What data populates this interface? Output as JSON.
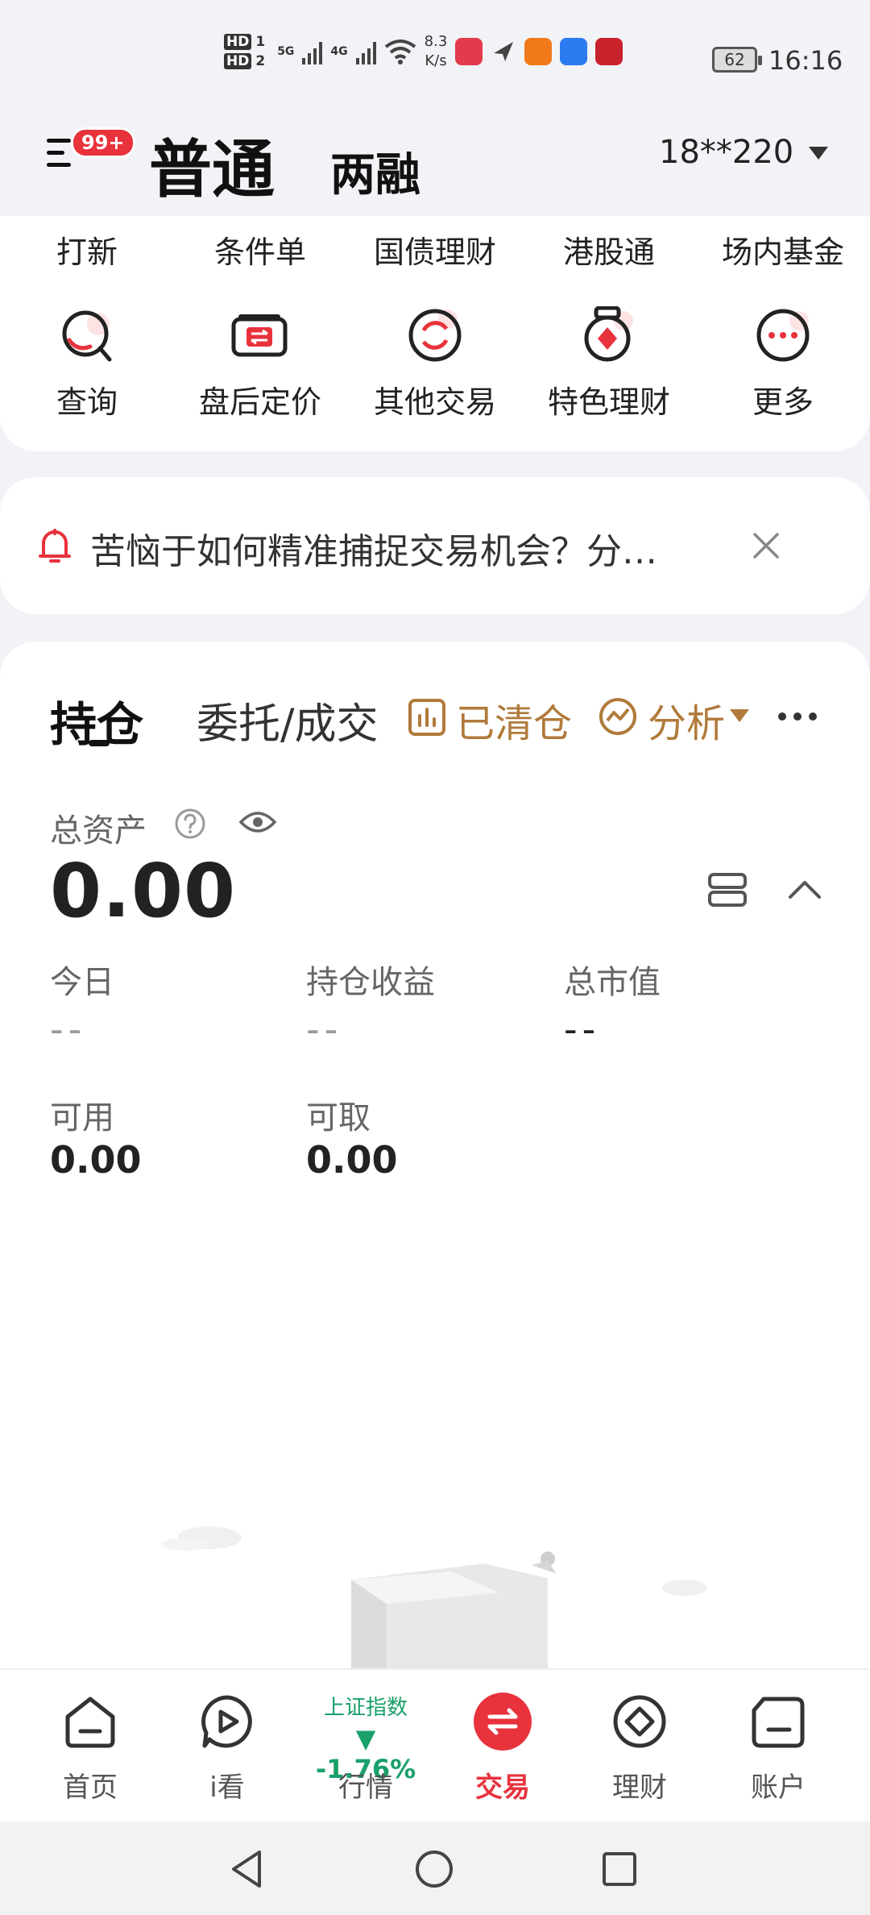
{
  "status_bar": {
    "hd1": "HD",
    "hd1_sub": "1",
    "hd2": "HD",
    "hd2_sub": "2",
    "net1": "5G",
    "net2": "4G",
    "speed_value": "8.3",
    "speed_unit": "K/s",
    "battery": "62",
    "time": "16:16"
  },
  "header": {
    "badge": "99+",
    "tab_normal": "普通",
    "tab_margin": "两融",
    "account": "18**220"
  },
  "quick_links": [
    "打新",
    "条件单",
    "国债理财",
    "港股通",
    "场内基金"
  ],
  "quick_actions": [
    {
      "label": "查询",
      "icon": "search-icon"
    },
    {
      "label": "盘后定价",
      "icon": "after-hours-pricing-icon"
    },
    {
      "label": "其他交易",
      "icon": "other-trade-icon"
    },
    {
      "label": "特色理财",
      "icon": "featured-wealth-icon"
    },
    {
      "label": "更多",
      "icon": "more-icon"
    }
  ],
  "notice": {
    "text": "苦恼于如何精准捕捉交易机会？分…"
  },
  "positions": {
    "tab_holdings": "持仓",
    "tab_orders": "委托/成交",
    "cleared_label": "已清仓",
    "analysis_label": "分析",
    "total_assets_label": "总资产",
    "total_assets_value": "0.00",
    "today_label": "今日",
    "today_value": "--",
    "holding_profit_label": "持仓收益",
    "holding_profit_value": "--",
    "market_value_label": "总市值",
    "market_value_value": "--",
    "available_label": "可用",
    "available_value": "0.00",
    "withdrawable_label": "可取",
    "withdrawable_value": "0.00"
  },
  "bottom_nav": {
    "home": "首页",
    "watch": "i看",
    "index_name": "上证指数",
    "index_change": "▼ -1.76%",
    "market": "行情",
    "trade": "交易",
    "wealth": "理财",
    "account": "账户"
  },
  "colors": {
    "accent_red": "#e8323c",
    "gold": "#b07a3a",
    "down_green": "#1aa06a"
  }
}
